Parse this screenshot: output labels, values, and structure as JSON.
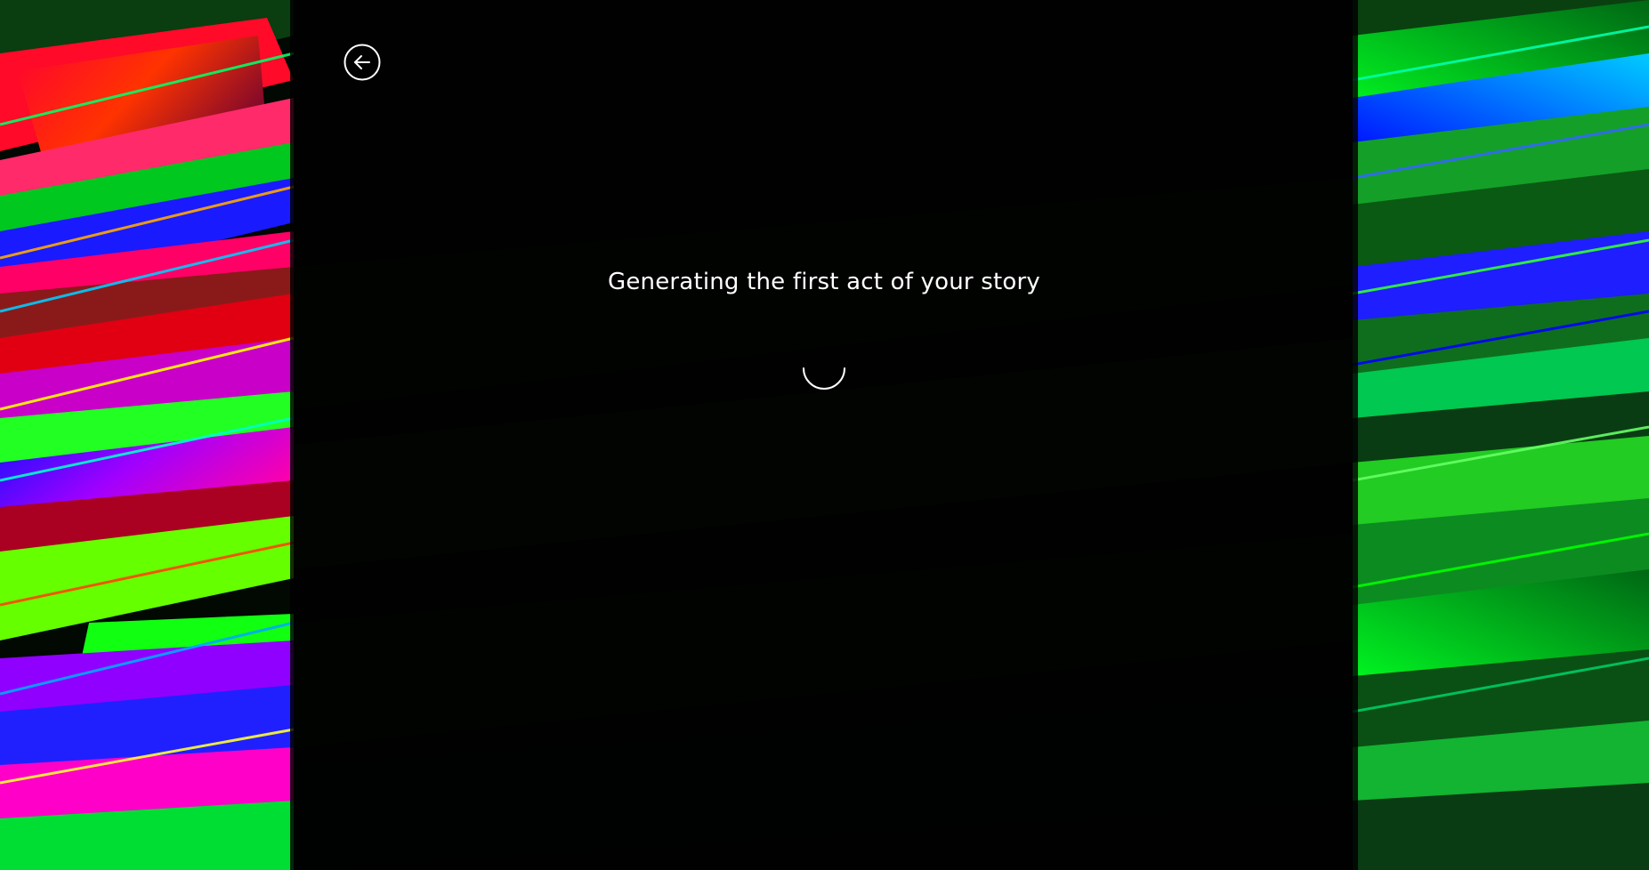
{
  "loading": {
    "message": "Generating the first act of your story"
  },
  "icons": {
    "back": "arrow-left-circle-icon",
    "spinner": "loading-spinner-icon"
  },
  "colors": {
    "text": "#ffffff",
    "overlay": "#000000"
  }
}
